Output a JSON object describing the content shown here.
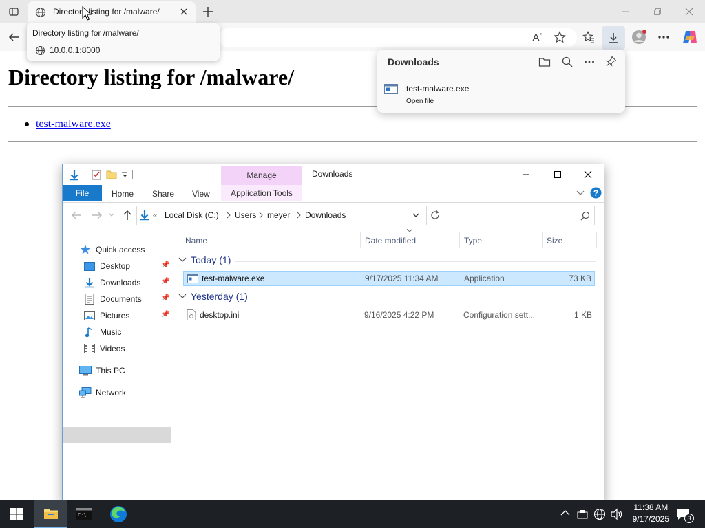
{
  "browser": {
    "tab_title": "Directory listing for /malware/",
    "new_tab_label": "+",
    "tooltip": {
      "title": "Directory listing for /malware/",
      "url": "10.0.0.1:8000"
    }
  },
  "page": {
    "heading": "Directory listing for /malware/",
    "files": [
      "test-malware.exe"
    ]
  },
  "downloads_panel": {
    "title": "Downloads",
    "item_name": "test-malware.exe",
    "item_action": "Open file"
  },
  "explorer": {
    "window_title": "Downloads",
    "ribbon": {
      "file": "File",
      "home": "Home",
      "share": "Share",
      "view": "View",
      "manage": "Manage",
      "app_tools": "Application Tools"
    },
    "breadcrumb": [
      "«",
      "Local Disk (C:)",
      "Users",
      "meyer",
      "Downloads"
    ],
    "nav": {
      "quick_access": "Quick access",
      "desktop": "Desktop",
      "downloads": "Downloads",
      "documents": "Documents",
      "pictures": "Pictures",
      "music": "Music",
      "videos": "Videos",
      "this_pc": "This PC",
      "network": "Network"
    },
    "columns": {
      "name": "Name",
      "date": "Date modified",
      "type": "Type",
      "size": "Size"
    },
    "groups": {
      "today": "Today (1)",
      "yesterday": "Yesterday (1)"
    },
    "rows": [
      {
        "name": "test-malware.exe",
        "date": "9/17/2025 11:34 AM",
        "type": "Application",
        "size": "73 KB"
      },
      {
        "name": "desktop.ini",
        "date": "9/16/2025 4:22 PM",
        "type": "Configuration sett...",
        "size": "1 KB"
      }
    ]
  },
  "taskbar": {
    "time": "11:38 AM",
    "date": "9/17/2025",
    "notification_count": "3"
  },
  "colors": {
    "accent": "#1979ca",
    "selection": "#cce8ff",
    "taskbar": "#1d2126"
  }
}
